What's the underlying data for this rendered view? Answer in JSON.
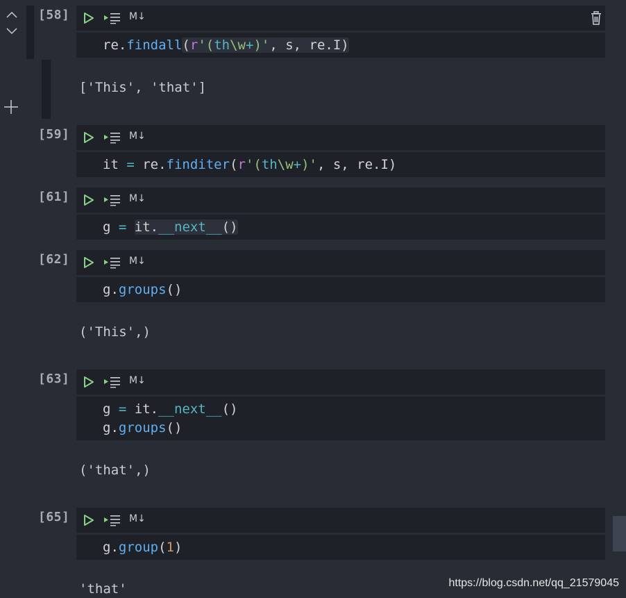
{
  "nav": {
    "up_icon": "chevron-up-icon",
    "down_icon": "chevron-down-icon",
    "add_icon": "plus-icon"
  },
  "toolbar": {
    "run_icon": "run-cell-icon",
    "run_below_icon": "run-below-icon",
    "lang_label": "M↓",
    "delete_icon": "trash-icon"
  },
  "colors": {
    "background": "#282c34",
    "cell": "#1e2128",
    "run": "#89d185",
    "function": "#61afef",
    "keyword": "#c678dd",
    "string": "#98c379",
    "number": "#d19a66"
  },
  "cells": [
    {
      "count": "[58]",
      "code": [
        "re.findall(r'(th\\w+)', s, re.I)"
      ],
      "output": "['This', 'that']"
    },
    {
      "count": "[59]",
      "code": [
        "it = re.finditer(r'(th\\w+)', s, re.I)"
      ],
      "output": ""
    },
    {
      "count": "[61]",
      "code": [
        "g = it.__next__()"
      ],
      "output": ""
    },
    {
      "count": "[62]",
      "code": [
        "g.groups()"
      ],
      "output": "('This',)"
    },
    {
      "count": "[63]",
      "code": [
        "g = it.__next__()",
        "g.groups()"
      ],
      "output": "('that',)"
    },
    {
      "count": "[65]",
      "code": [
        "g.group(1)"
      ],
      "output": "'that'"
    }
  ],
  "watermark": "https://blog.csdn.net/qq_21579045"
}
